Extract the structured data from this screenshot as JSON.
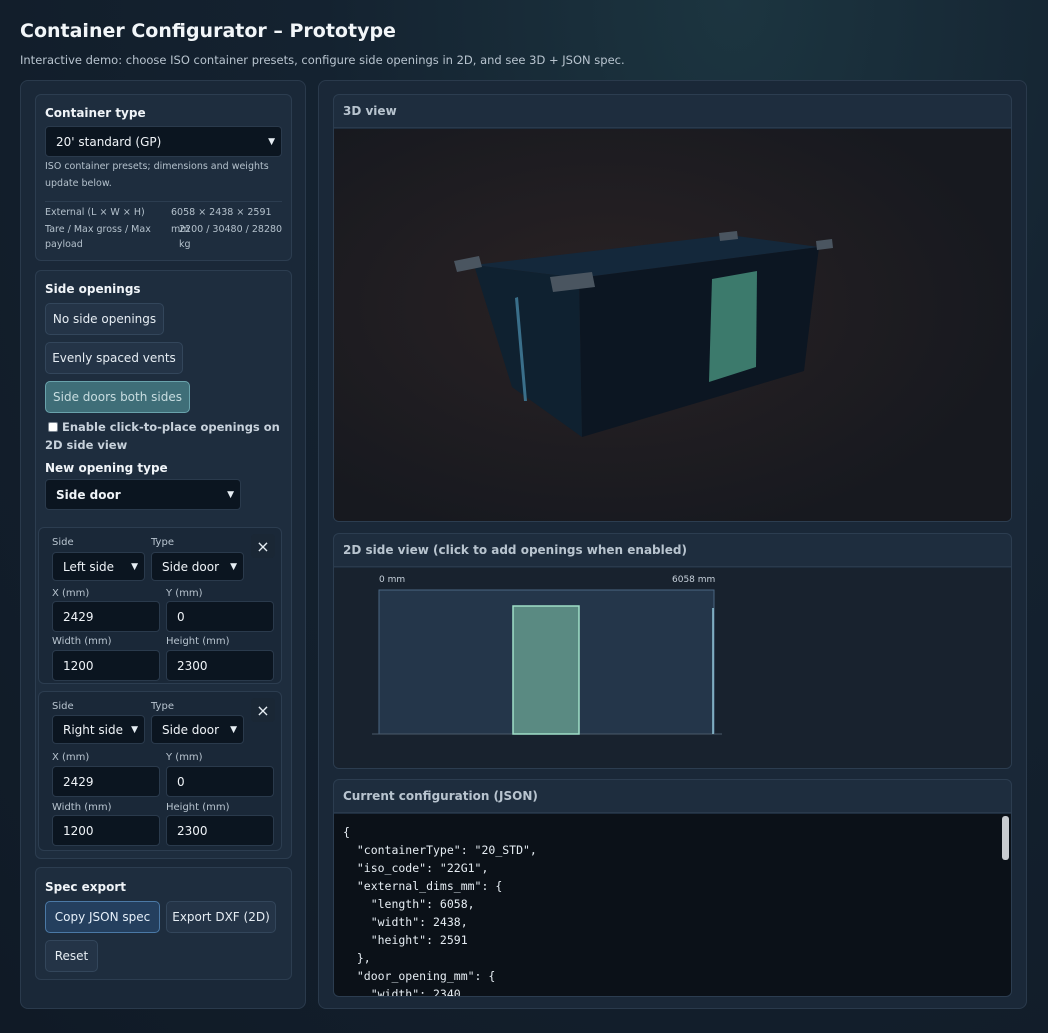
{
  "header": {
    "title": "Container Configurator – Prototype",
    "subtitle": "Interactive demo: choose ISO container presets, configure side openings in 2D, and see 3D + JSON spec."
  },
  "container_type": {
    "title": "Container type",
    "selected": "20' standard (GP)",
    "hint": "ISO container presets; dimensions and weights update below.",
    "external_label": "External (L × W × H)",
    "external_value": "6058 × 2438 × 2591 mm",
    "weights_label": "Tare / Max gross / Max payload",
    "weights_value": "2200 / 30480 / 28280 kg"
  },
  "side_openings": {
    "title": "Side openings",
    "presets": [
      "No side openings",
      "Evenly spaced vents",
      "Side doors both sides"
    ],
    "active_preset": "Side doors both sides",
    "checkbox_label": "Enable click-to-place openings on 2D side view",
    "checkbox_checked": false,
    "new_type_label": "New opening type",
    "new_type_value": "Side door",
    "openings": [
      {
        "side_label": "Side",
        "side": "Left side",
        "type_label": "Type",
        "type": "Side door",
        "x_label": "X (mm)",
        "x": "2429",
        "y_label": "Y (mm)",
        "y": "0",
        "w_label": "Width (mm)",
        "w": "1200",
        "h_label": "Height (mm)",
        "h": "2300"
      },
      {
        "side_label": "Side",
        "side": "Right side",
        "type_label": "Type",
        "type": "Side door",
        "x_label": "X (mm)",
        "x": "2429",
        "y_label": "Y (mm)",
        "y": "0",
        "w_label": "Width (mm)",
        "w": "1200",
        "h_label": "Height (mm)",
        "h": "2300"
      }
    ],
    "close_icon": "×"
  },
  "spec_export": {
    "title": "Spec export",
    "copy_label": "Copy JSON spec",
    "dxf_label": "Export DXF (2D)",
    "reset_label": "Reset"
  },
  "view3d": {
    "title": "3D view"
  },
  "view2d": {
    "title": "2D side view (click to add openings when enabled)",
    "start_label": "0 mm",
    "end_label": "6058 mm"
  },
  "json_panel": {
    "title": "Current configuration (JSON)",
    "text": "{\n  \"containerType\": \"20_STD\",\n  \"iso_code\": \"22G1\",\n  \"external_dims_mm\": {\n    \"length\": 6058,\n    \"width\": 2438,\n    \"height\": 2591\n  },\n  \"door_opening_mm\": {\n    \"width\": 2340,"
  },
  "colors": {
    "accent": "#6aa3ac",
    "door": "#4f8a7e",
    "background": "#101a26"
  }
}
